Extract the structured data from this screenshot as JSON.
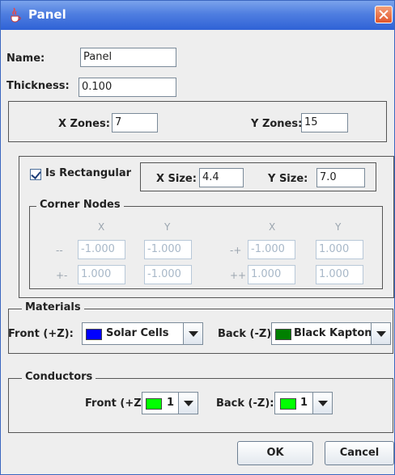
{
  "window": {
    "title": "Panel",
    "icon": "java-cup-icon"
  },
  "name": {
    "label": "Name:",
    "value": "Panel"
  },
  "thickness": {
    "label": "Thickness:",
    "value": "0.100"
  },
  "zones": {
    "x_label": "X Zones:",
    "x_value": "7",
    "y_label": "Y Zones:",
    "y_value": "15"
  },
  "shape": {
    "is_rectangular_label": "Is Rectangular",
    "is_rectangular_checked": true,
    "x_size_label": "X Size:",
    "x_size": "4.4",
    "y_size_label": "Y Size:",
    "y_size": "7.0"
  },
  "corner_nodes": {
    "title": "Corner Nodes",
    "col_x": "X",
    "col_y": "Y",
    "col_x2": "X",
    "col_y2": "Y",
    "rows": [
      {
        "label_left": "--",
        "x1": "-1.000",
        "y1": "-1.000",
        "label_right": "-+",
        "x2": "-1.000",
        "y2": "1.000"
      },
      {
        "label_left": "+-",
        "x1": "1.000",
        "y1": "-1.000",
        "label_right": "++",
        "x2": "1.000",
        "y2": "1.000"
      }
    ]
  },
  "materials": {
    "title": "Materials",
    "front_label": "Front (+Z):",
    "front_value": "Solar Cells",
    "front_color": "#0000ff",
    "back_label": "Back (-Z):",
    "back_value": "Black Kapton",
    "back_color": "#008000"
  },
  "conductors": {
    "title": "Conductors",
    "front_label": "Front (+Z):",
    "front_value": "1",
    "front_color": "#00ff00",
    "back_label": "Back (-Z):",
    "back_value": "1",
    "back_color": "#00ff00"
  },
  "buttons": {
    "ok": "OK",
    "cancel": "Cancel"
  }
}
